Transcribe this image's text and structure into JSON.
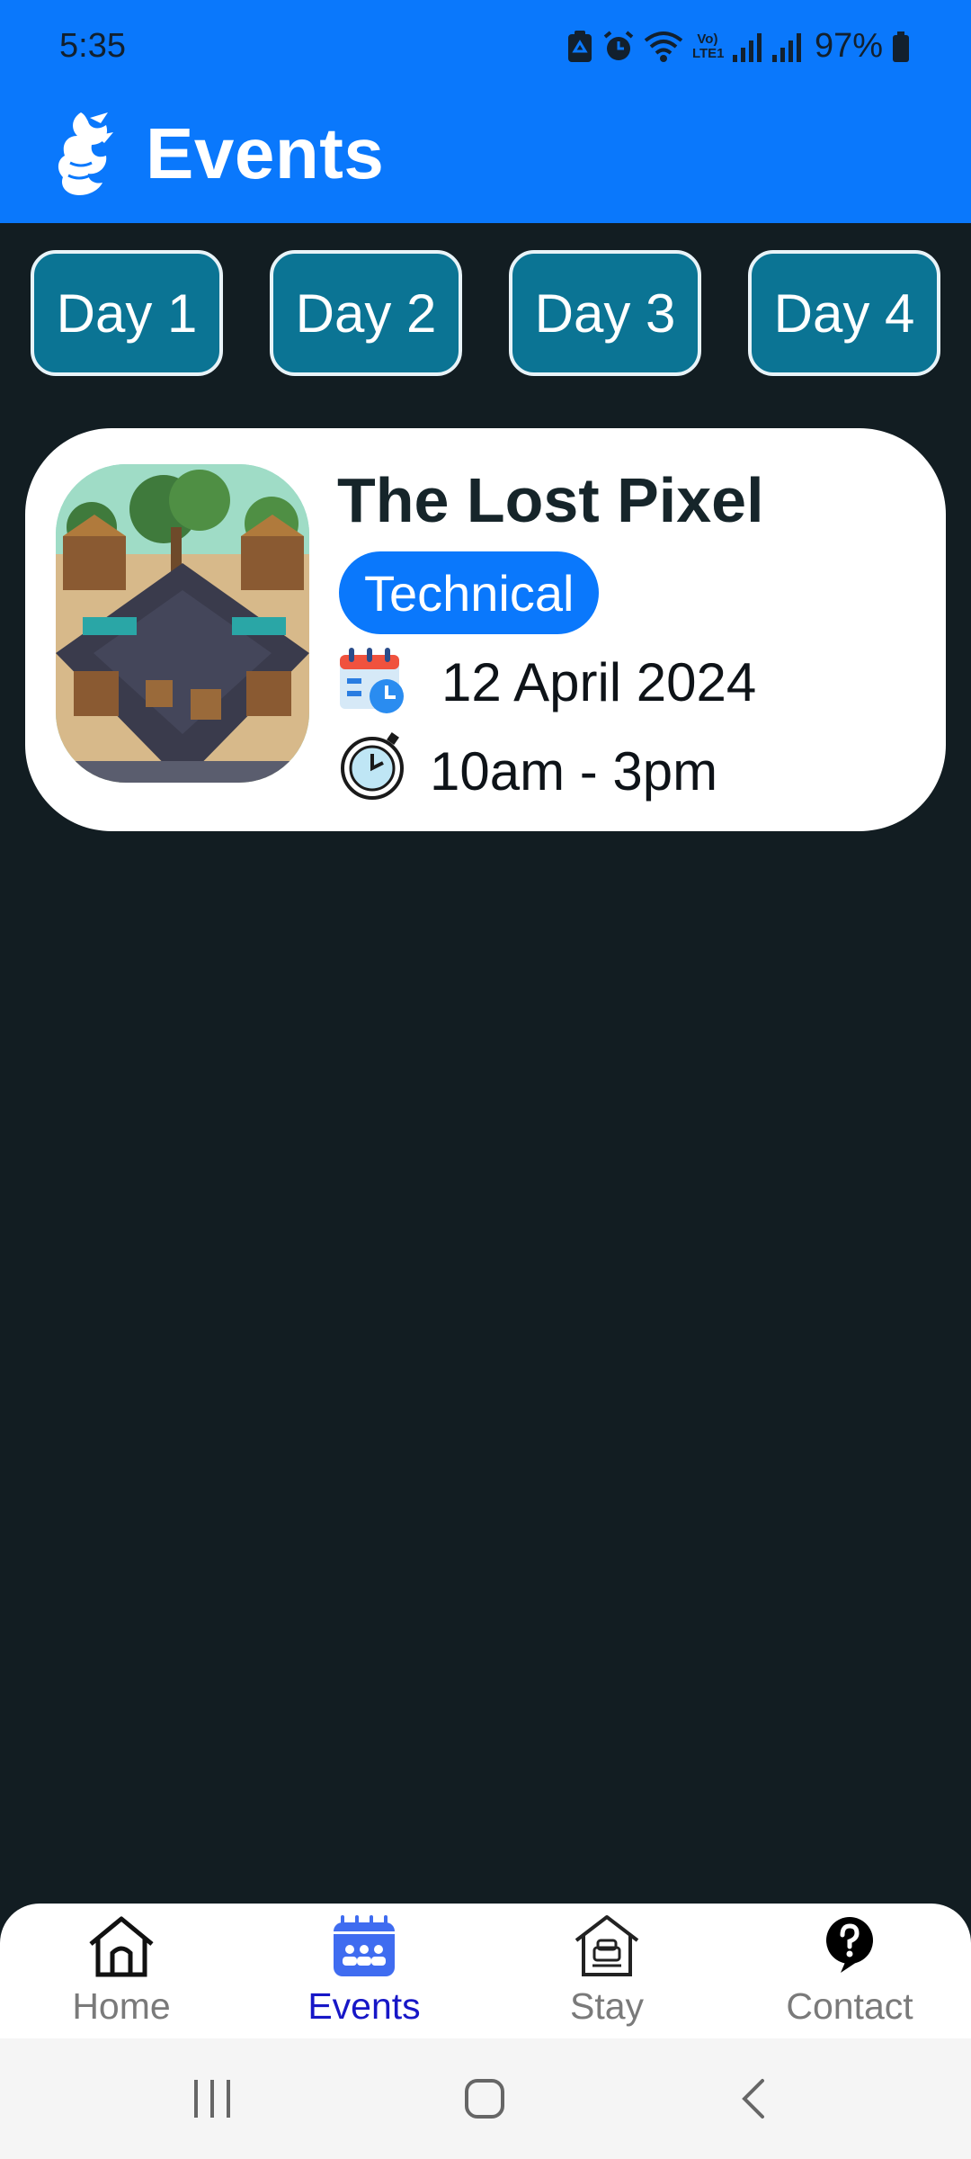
{
  "status_bar": {
    "time": "5:35",
    "battery_percent": "97%",
    "network_label": "Vo) LTE1"
  },
  "header": {
    "title": "Events",
    "background_color": "#0a78fc"
  },
  "day_tabs": [
    {
      "label": "Day 1"
    },
    {
      "label": "Day 2"
    },
    {
      "label": "Day 3"
    },
    {
      "label": "Day 4"
    }
  ],
  "events": [
    {
      "title": "The Lost Pixel",
      "category": "Technical",
      "date": "12 April 2024",
      "time": "10am - 3pm",
      "thumbnail_icon": "pixel-village-image"
    }
  ],
  "bottom_nav": {
    "items": [
      {
        "label": "Home",
        "icon": "home-icon"
      },
      {
        "label": "Events",
        "icon": "events-icon",
        "active": true
      },
      {
        "label": "Stay",
        "icon": "stay-icon"
      },
      {
        "label": "Contact",
        "icon": "help-icon"
      }
    ],
    "active_color": "#1717c7"
  },
  "system_nav": {
    "items": [
      "recent-apps",
      "home",
      "back"
    ]
  }
}
